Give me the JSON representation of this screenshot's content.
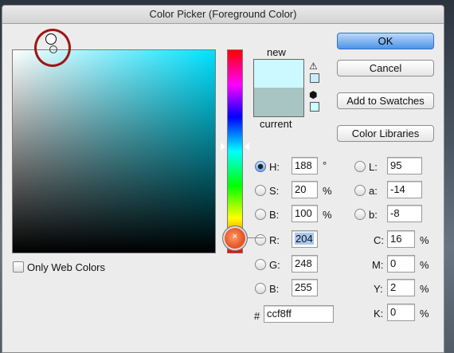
{
  "window": {
    "title": "Color Picker (Foreground Color)"
  },
  "preview": {
    "new_label": "new",
    "current_label": "current",
    "new_color": "#ccf8ff",
    "current_color": "#a8c5c3"
  },
  "buttons": {
    "ok": "OK",
    "cancel": "Cancel",
    "add_to_swatches": "Add to Swatches",
    "color_libraries": "Color Libraries"
  },
  "options": {
    "only_web_colors": "Only Web Colors"
  },
  "hsb": [
    {
      "key": "H",
      "label": "H:",
      "value": "188",
      "unit": "°",
      "selected": true
    },
    {
      "key": "S",
      "label": "S:",
      "value": "20",
      "unit": "%",
      "selected": false
    },
    {
      "key": "B",
      "label": "B:",
      "value": "100",
      "unit": "%",
      "selected": false
    }
  ],
  "rgb": [
    {
      "key": "R",
      "label": "R:",
      "value": "204",
      "selected": false
    },
    {
      "key": "G",
      "label": "G:",
      "value": "248",
      "selected": false
    },
    {
      "key": "B",
      "label": "B:",
      "value": "255",
      "selected": false
    }
  ],
  "lab": [
    {
      "key": "L",
      "label": "L:",
      "value": "95"
    },
    {
      "key": "a",
      "label": "a:",
      "value": "-14"
    },
    {
      "key": "b",
      "label": "b:",
      "value": "-8"
    }
  ],
  "cmyk": [
    {
      "key": "C",
      "label": "C:",
      "value": "16",
      "unit": "%"
    },
    {
      "key": "M",
      "label": "M:",
      "value": "0",
      "unit": "%"
    },
    {
      "key": "Y",
      "label": "Y:",
      "value": "2",
      "unit": "%"
    },
    {
      "key": "K",
      "label": "K:",
      "value": "0",
      "unit": "%"
    }
  ],
  "hex": {
    "prefix": "#",
    "value": "ccf8ff"
  },
  "colors": {
    "hue_base": "#00e1ff",
    "default_button": "#4b94e9",
    "annotation_circle": "#a01515"
  }
}
